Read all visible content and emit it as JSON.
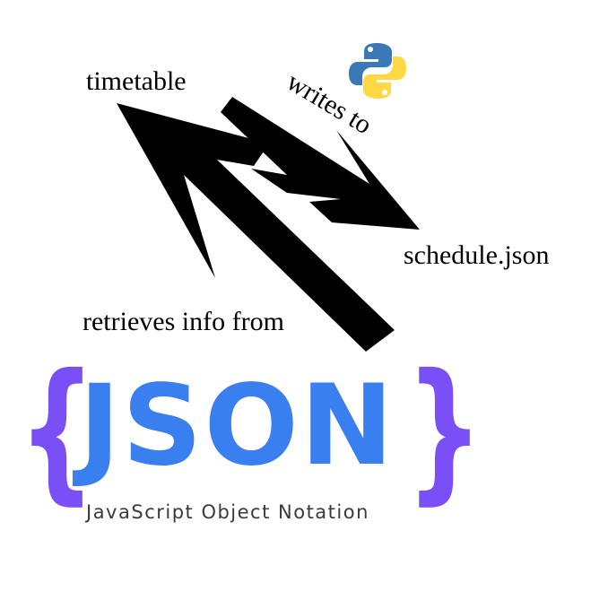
{
  "labels": {
    "timetable": "timetable",
    "schedule": "schedule.json",
    "retrieves": "retrieves info from",
    "writes": "writes to"
  },
  "json_logo": {
    "word": "JSON",
    "subtitle": "JavaScript Object Notation",
    "brace_left": "{",
    "brace_right": "}"
  },
  "icons": {
    "python": "python-logo-icon",
    "arrows": "arrow-icon"
  },
  "colors": {
    "json_blue": "#3a7ff0",
    "brace_purple": "#7a4ff5",
    "python_blue": "#3b78b8",
    "python_yellow": "#ffd843",
    "subtitle_gray": "#3a3a3a"
  }
}
